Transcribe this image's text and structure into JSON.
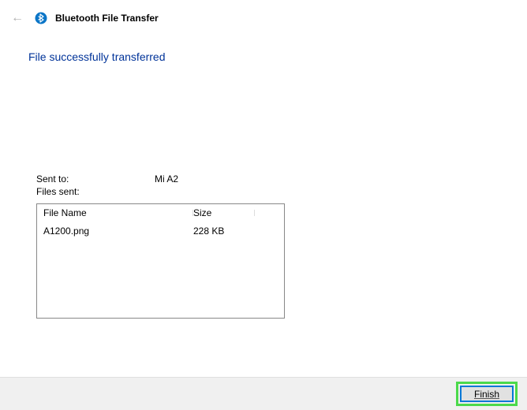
{
  "header": {
    "title": "Bluetooth File Transfer"
  },
  "status_heading": "File successfully transferred",
  "info": {
    "sent_to_label": "Sent to:",
    "sent_to_value": "Mi A2",
    "files_sent_label": "Files sent:"
  },
  "table": {
    "columns": {
      "name": "File Name",
      "size": "Size"
    },
    "rows": [
      {
        "name": "A1200.png",
        "size": "228 KB"
      }
    ]
  },
  "footer": {
    "finish_label": "Finish"
  }
}
